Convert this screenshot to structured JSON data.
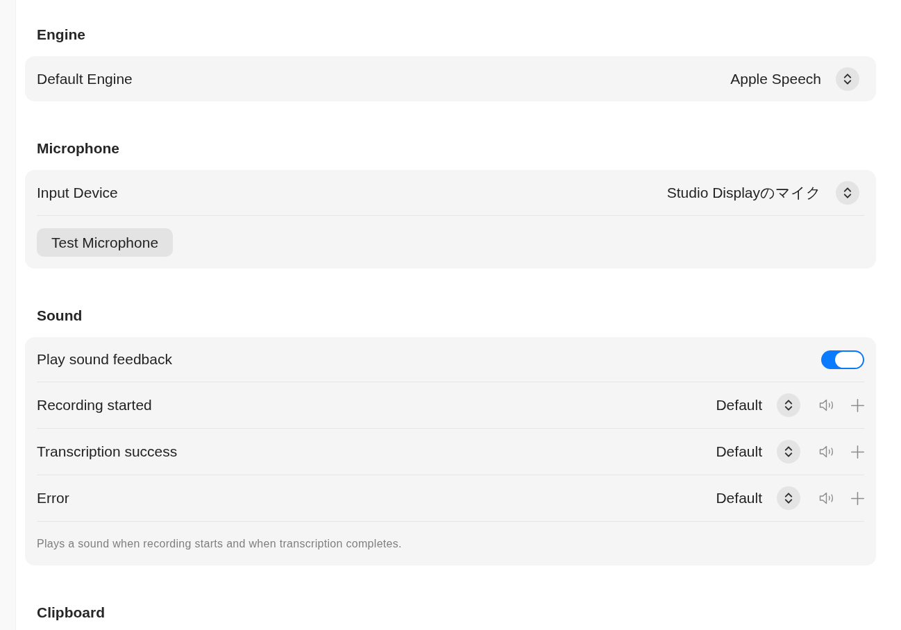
{
  "sections": [
    {
      "title": "Engine",
      "rows": [
        {
          "kind": "select",
          "label": "Default Engine",
          "value": "Apple Speech"
        }
      ]
    },
    {
      "title": "Microphone",
      "rows": [
        {
          "kind": "select",
          "label": "Input Device",
          "value": "Studio Displayのマイク"
        },
        {
          "kind": "button",
          "label": "Test Microphone"
        }
      ]
    },
    {
      "title": "Sound",
      "rows": [
        {
          "kind": "toggle",
          "label": "Play sound feedback",
          "on": true
        },
        {
          "kind": "sound",
          "label": "Recording started",
          "value": "Default"
        },
        {
          "kind": "sound",
          "label": "Transcription success",
          "value": "Default"
        },
        {
          "kind": "sound",
          "label": "Error",
          "value": "Default"
        },
        {
          "kind": "note",
          "text": "Plays a sound when recording starts and when transcription completes."
        }
      ]
    },
    {
      "title": "Clipboard"
    }
  ]
}
